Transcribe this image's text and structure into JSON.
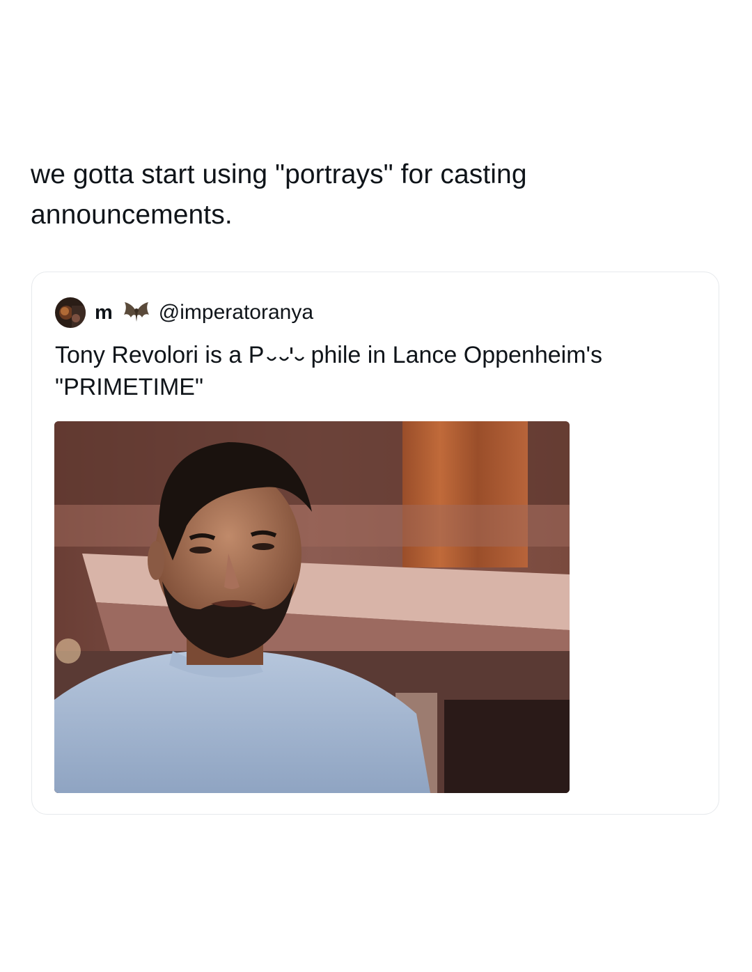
{
  "post": {
    "text": "we gotta start using \"portrays\" for casting announcements."
  },
  "quoted_tweet": {
    "display_name": "m",
    "emoji_icon": "bat-icon",
    "handle": "@imperatoranya",
    "text_before": "Tony Revolori is a ",
    "text_censored_start": "P",
    "text_after": "phile in Lance Oppenheim's \"PRIMETIME\"",
    "media": {
      "icon": "photo-man-in-blue-tshirt"
    }
  },
  "colors": {
    "text": "#0f1419",
    "card_border": "#e6e9ec",
    "background": "#ffffff"
  }
}
